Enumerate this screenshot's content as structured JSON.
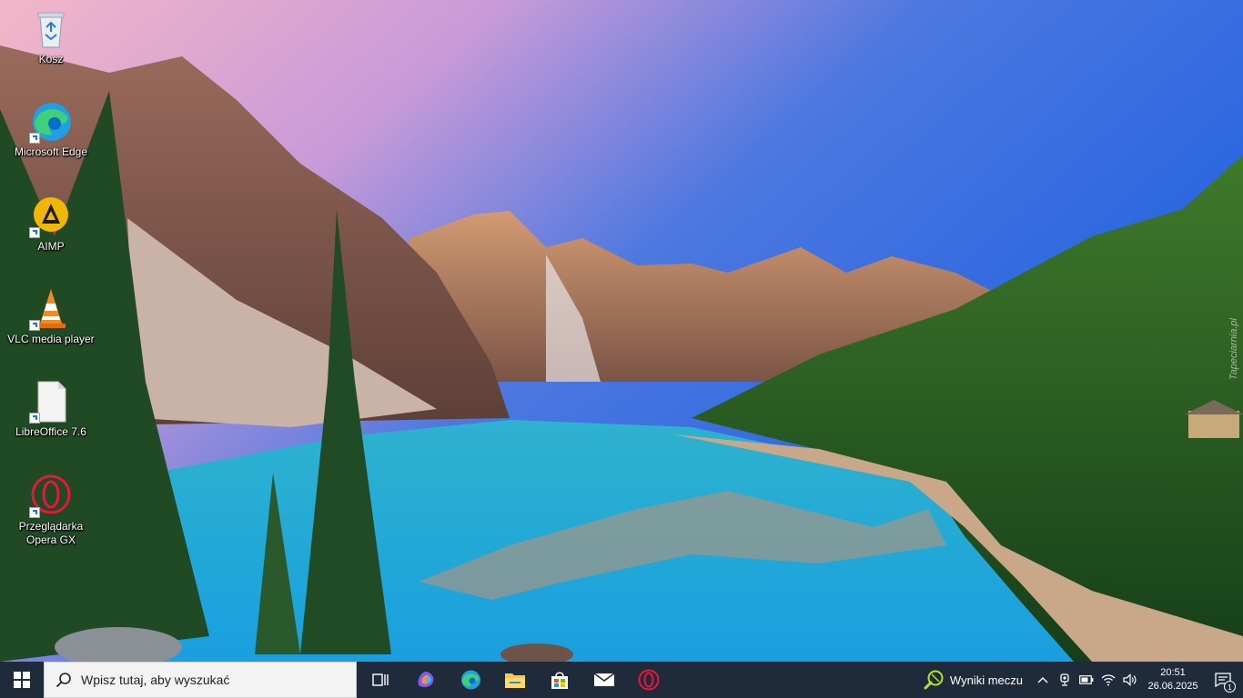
{
  "desktop": {
    "watermark": "Tapeciarnia.pl",
    "icons": [
      {
        "label": "Kosz",
        "icon": "recycle-bin-icon"
      },
      {
        "label": "Microsoft Edge",
        "icon": "edge-icon"
      },
      {
        "label": "AIMP",
        "icon": "aimp-icon"
      },
      {
        "label": "VLC media player",
        "icon": "vlc-icon"
      },
      {
        "label": "LibreOffice 7.6",
        "icon": "libreoffice-icon"
      },
      {
        "label": "Przeglądarka Opera GX",
        "icon": "opera-gx-icon"
      }
    ]
  },
  "taskbar": {
    "search_placeholder": "Wpisz tutaj, aby wyszukać",
    "pinned": [
      "task-view-icon",
      "copilot-icon",
      "edge-icon",
      "file-explorer-icon",
      "store-icon",
      "mail-icon",
      "opera-icon"
    ],
    "weather_text": "Wyniki meczu",
    "clock_time": "20:51",
    "clock_date": "26.06.2025",
    "notification_count": "1",
    "colors": {
      "bar": "#1f2b3a",
      "search_bg": "#f3f3f3"
    }
  }
}
